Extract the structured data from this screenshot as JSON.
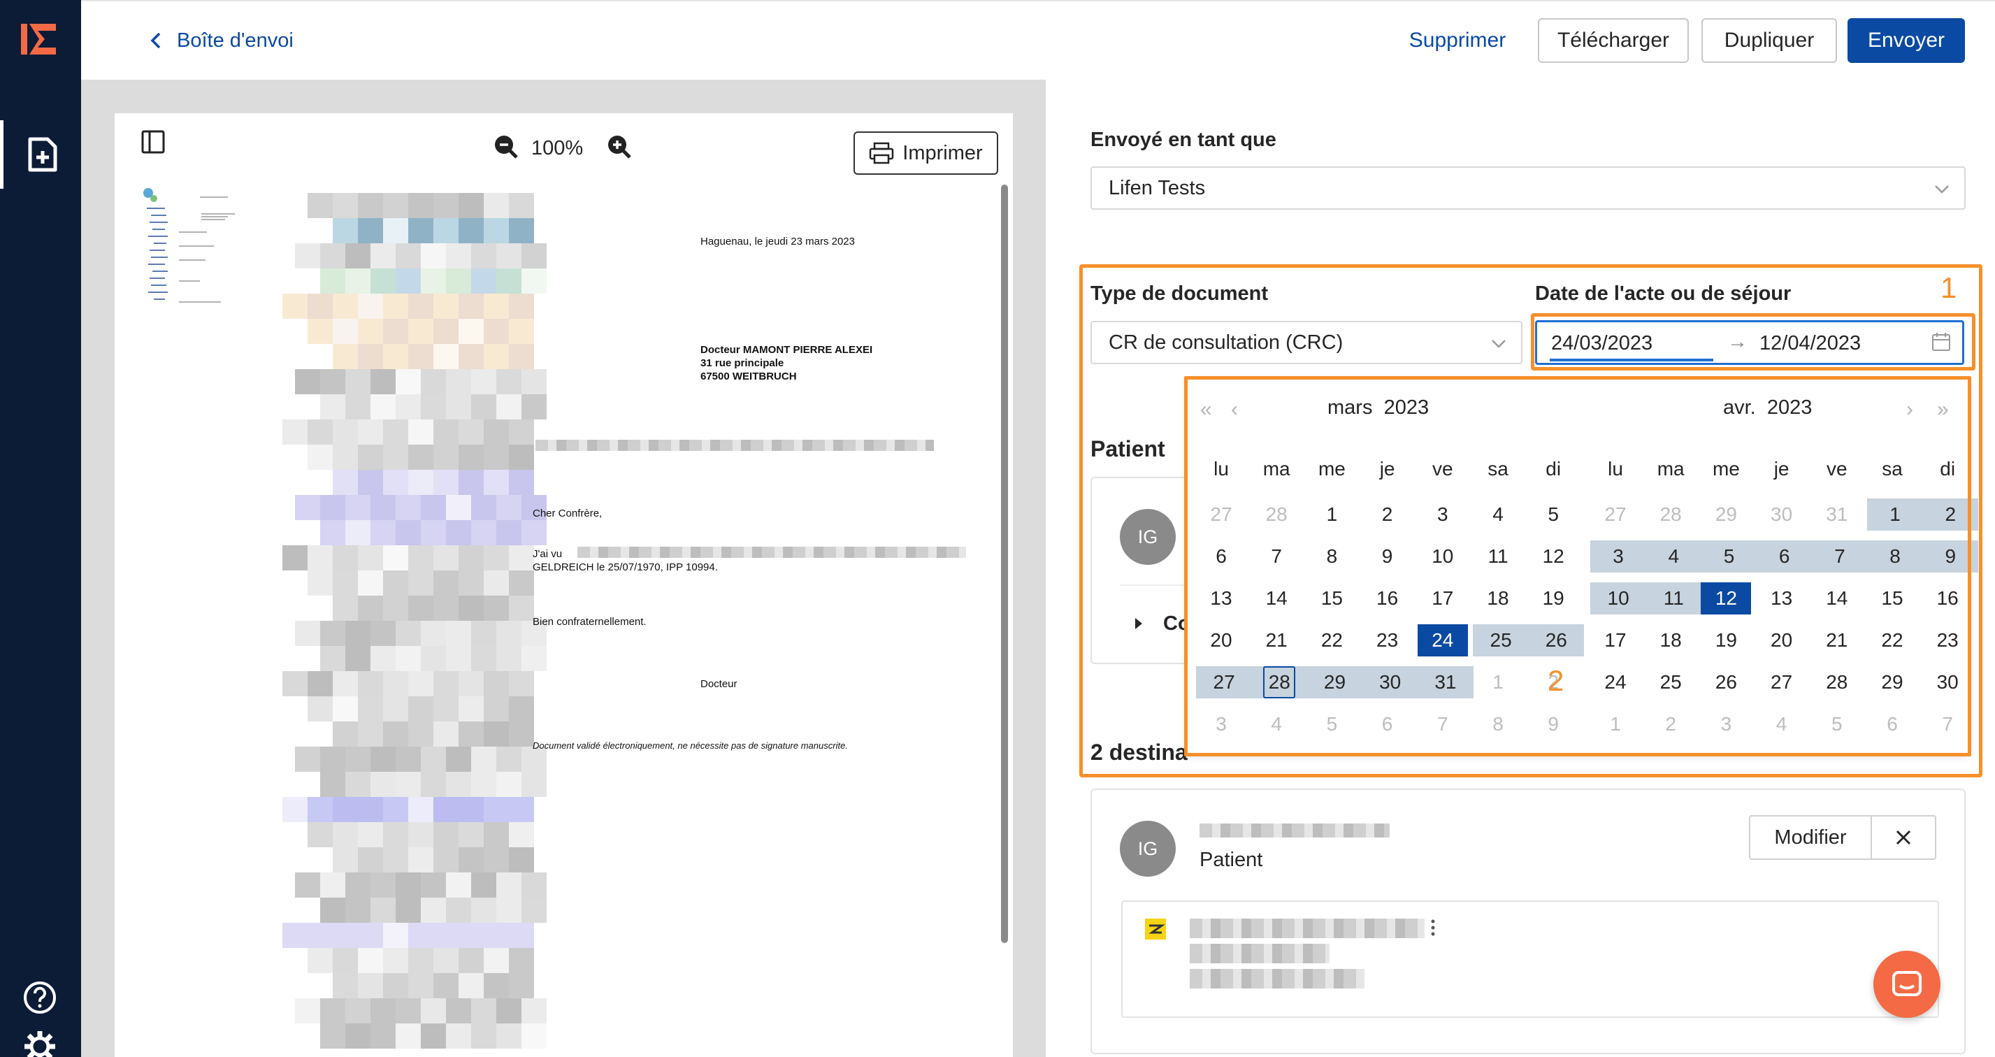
{
  "header": {
    "back_label": "Boîte d'envoi",
    "delete_label": "Supprimer",
    "download_label": "Télécharger",
    "duplicate_label": "Dupliquer",
    "send_label": "Envoyer"
  },
  "preview": {
    "zoom": "100%",
    "print_label": "Imprimer",
    "letter": {
      "place_date": "Haguenau, le jeudi 23 mars 2023",
      "recipient_name": "Docteur MAMONT PIERRE ALEXEI",
      "recipient_street": "31 rue principale",
      "recipient_city": "67500 WEITBRUCH",
      "greeting": "Cher Confrère,",
      "body_start": "J'ai  vu",
      "body_line2": "GELDREICH le 25/07/1970, IPP 10994.",
      "closing": "Bien confraternellement.",
      "signature": "Docteur",
      "footer": "Document validé électroniquement, ne nécessite pas de signature manuscrite."
    }
  },
  "form": {
    "sent_as_label": "Envoyé en tant que",
    "sent_as_value": "Lifen Tests",
    "doc_type_label": "Type de document",
    "doc_type_value": "CR de consultation (CRC)",
    "date_label": "Date de l'acte ou de séjour",
    "date_start": "24/03/2023",
    "date_arrow": "→",
    "date_end": "12/04/2023",
    "patient_label": "Patient",
    "patient_avatar": "IG",
    "patient_expand": "Co",
    "recipients_label": "2 destina",
    "recipient_avatar": "IG",
    "recipient_role": "Patient",
    "modify_label": "Modifier"
  },
  "annotations": {
    "one": "1",
    "two": "2"
  },
  "calendar": {
    "left": {
      "month": "mars",
      "year": "2023",
      "weeks": [
        [
          "27",
          "28",
          "1",
          "2",
          "3",
          "4",
          "5"
        ],
        [
          "6",
          "7",
          "8",
          "9",
          "10",
          "11",
          "12"
        ],
        [
          "13",
          "14",
          "15",
          "16",
          "17",
          "18",
          "19"
        ],
        [
          "20",
          "21",
          "22",
          "23",
          "24",
          "25",
          "26"
        ],
        [
          "27",
          "28",
          "29",
          "30",
          "31",
          "1",
          "2"
        ],
        [
          "3",
          "4",
          "5",
          "6",
          "7",
          "8",
          "9"
        ]
      ]
    },
    "right": {
      "month": "avr.",
      "year": "2023",
      "weeks": [
        [
          "27",
          "28",
          "29",
          "30",
          "31",
          "1",
          "2"
        ],
        [
          "3",
          "4",
          "5",
          "6",
          "7",
          "8",
          "9"
        ],
        [
          "10",
          "11",
          "12",
          "13",
          "14",
          "15",
          "16"
        ],
        [
          "17",
          "18",
          "19",
          "20",
          "21",
          "22",
          "23"
        ],
        [
          "24",
          "25",
          "26",
          "27",
          "28",
          "29",
          "30"
        ],
        [
          "1",
          "2",
          "3",
          "4",
          "5",
          "6",
          "7"
        ]
      ]
    },
    "weekdays": [
      "lu",
      "ma",
      "me",
      "je",
      "ve",
      "sa",
      "di"
    ],
    "nav": {
      "prev_year": "«",
      "prev_month": "‹",
      "next_month": "›",
      "next_year": "»"
    }
  },
  "colors": {
    "sidebar": "#0c1b36",
    "accent": "#0b4aa2",
    "annotation": "#f5902b",
    "range": "#c7d3de",
    "chat": "#f46a45"
  }
}
